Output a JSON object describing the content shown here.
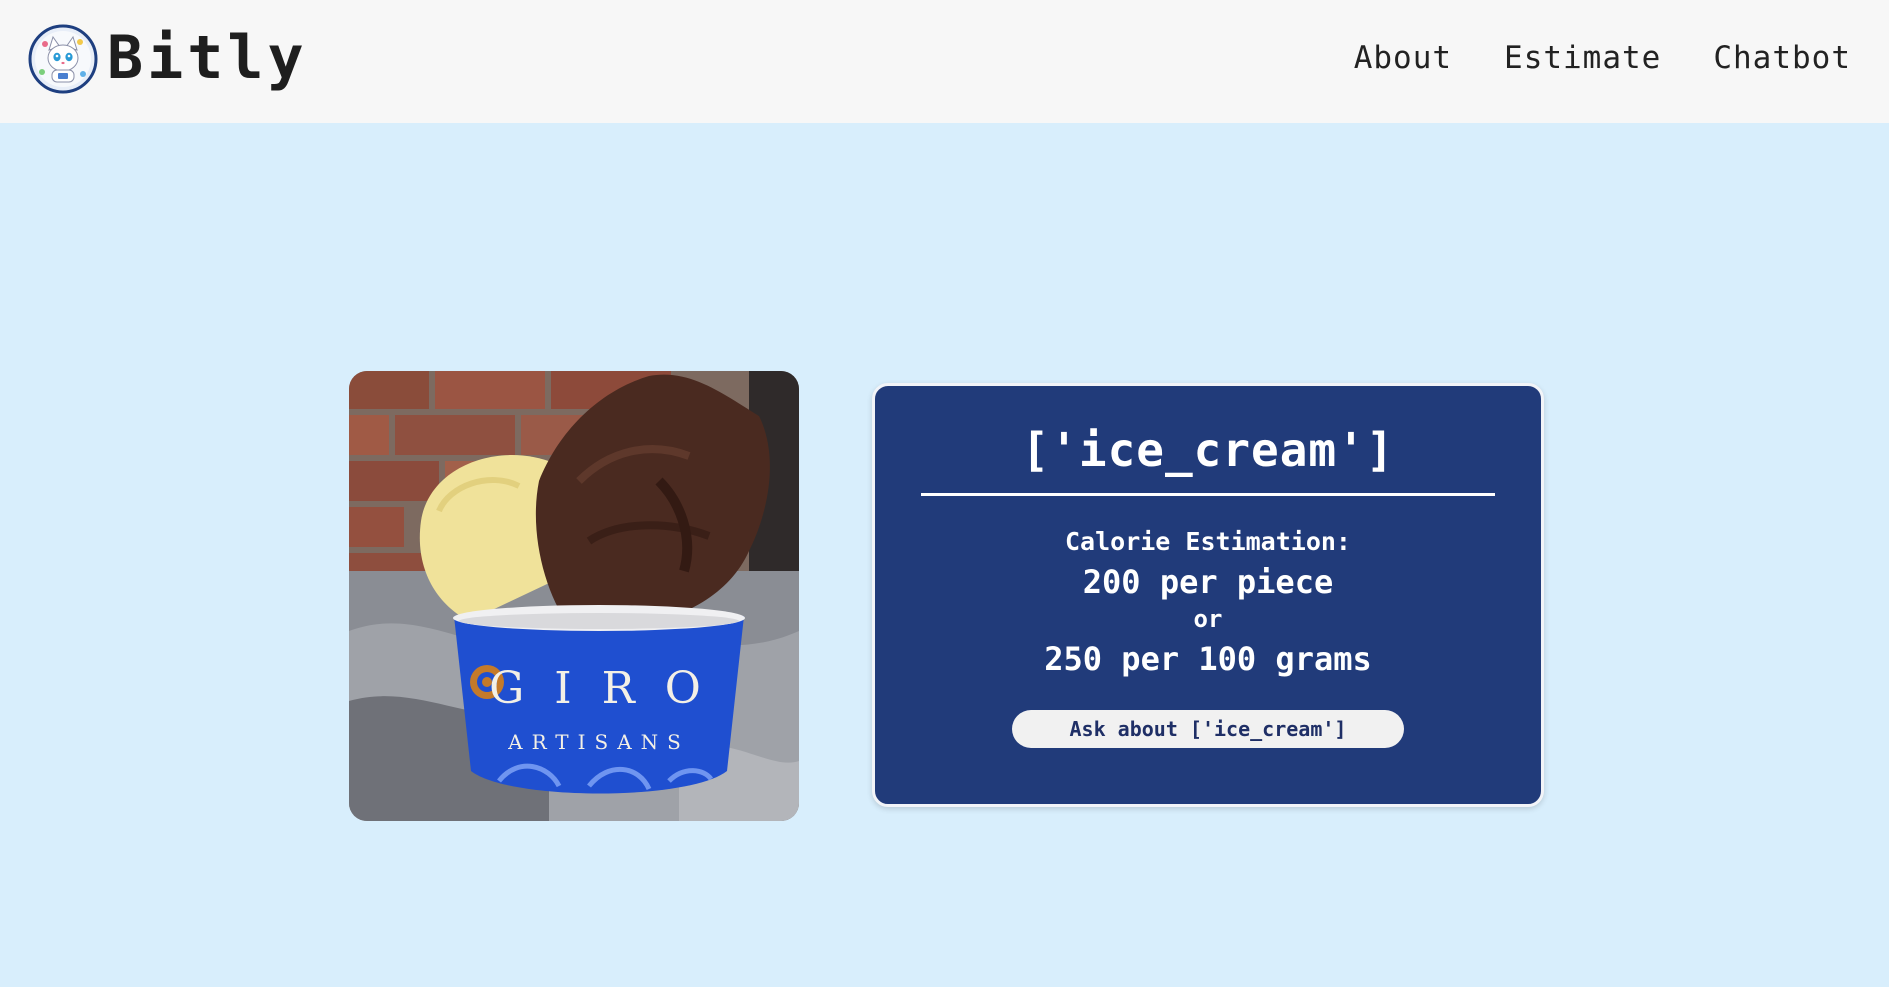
{
  "header": {
    "brand": "Bitly",
    "nav": [
      {
        "label": "About"
      },
      {
        "label": "Estimate"
      },
      {
        "label": "Chatbot"
      }
    ]
  },
  "result": {
    "title": "['ice_cream']",
    "calorie_label": "Calorie Estimation:",
    "per_piece": "200 per piece",
    "or_text": "or",
    "per_grams": "250 per 100 grams",
    "ask_button": "Ask about ['ice_cream']"
  },
  "photo": {
    "cup_text_top": "G I R O",
    "cup_text_bottom": "ARTISANS"
  },
  "colors": {
    "page_bg": "#d8eefc",
    "header_bg": "#f7f7f7",
    "card_bg": "#213b7a",
    "cup_blue": "#1f4fd0"
  },
  "icons": {
    "logo": "cat-mascot-icon"
  }
}
